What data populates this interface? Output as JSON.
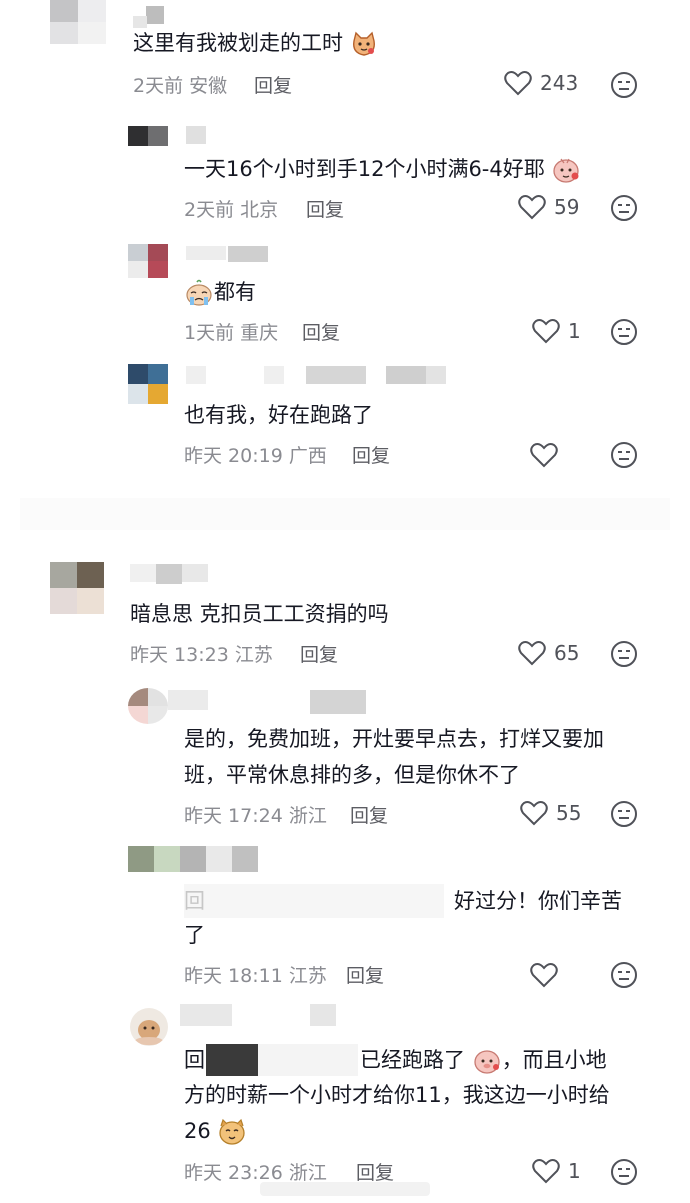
{
  "comments": [
    {
      "text": "这里有我被划走的工时",
      "time": "2天前",
      "location": "安徽",
      "reply_label": "回复",
      "likes": "243"
    },
    {
      "text": "一天16个小时到手12个小时满6-4好耶",
      "time": "2天前",
      "location": "北京",
      "reply_label": "回复",
      "likes": "59"
    },
    {
      "text": "都有",
      "time": "1天前",
      "location": "重庆",
      "reply_label": "回复",
      "likes": "1"
    },
    {
      "text": "也有我，好在跑路了",
      "time": "昨天 20:19",
      "location": "广西",
      "reply_label": "回复",
      "likes": ""
    },
    {
      "text": "暗息思 克扣员工工资捐的吗",
      "time": "昨天 13:23",
      "location": "江苏",
      "reply_label": "回复",
      "likes": "65"
    },
    {
      "text_line1": "是的，免费加班，开灶要早点去，打烊又要加",
      "text_line2": "班，平常休息排的多，但是你休不了",
      "time": "昨天 17:24",
      "location": "浙江",
      "reply_label": "回复",
      "likes": "55"
    },
    {
      "text_prefix": "回",
      "text_line1": "好过分！你们辛苦",
      "text_line2": "了",
      "time": "昨天 18:11",
      "location": "江苏",
      "reply_label": "回复",
      "likes": ""
    },
    {
      "text_prefix": "回",
      "text_line1": "已经跑路了",
      "text_line1b": "，而且小地",
      "text_line2": "方的时薪一个小时才给你11，我这边一小时给",
      "text_line3": "26",
      "time": "昨天 23:26",
      "location": "浙江",
      "reply_label": "回复",
      "likes": "1"
    }
  ],
  "colors": {
    "text": "#161823",
    "meta": "#8a8b91",
    "icon": "#505259"
  }
}
